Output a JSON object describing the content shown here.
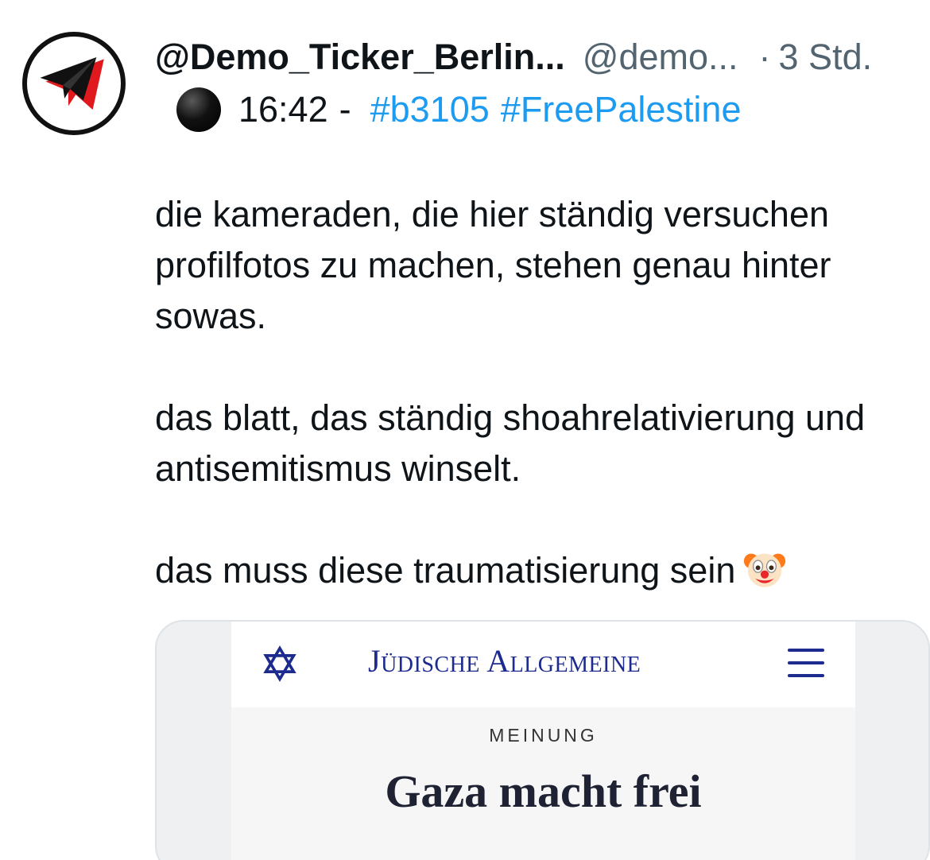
{
  "post": {
    "display_name": "@Demo_Ticker_Berlin...",
    "handle": "@demo...",
    "separator": "·",
    "time_ago": "3 Std.",
    "avatar_icon": "paper-plane-logo-icon",
    "status_icon": "black-circle-icon",
    "clock_time": "16:42",
    "dash": "-",
    "hashtags": [
      "#b3105",
      "#FreePalestine"
    ],
    "paragraphs": [
      "die kameraden, die hier ständig versuchen profilfotos zu machen, stehen genau hinter sowas.",
      "das blatt, das ständig shoahrelativierung und antisemitismus winselt.",
      "das muss diese traumatisierung sein"
    ],
    "trailing_emoji": "clown-face-icon"
  },
  "embed": {
    "masthead": "Jüdische Allgemeine",
    "section": "MEINUNG",
    "headline": "Gaza macht frei",
    "brand_color": "#1d2b8f"
  },
  "colors": {
    "hashtag": "#1d9bf0",
    "muted": "#536471",
    "text": "#0f1419"
  }
}
